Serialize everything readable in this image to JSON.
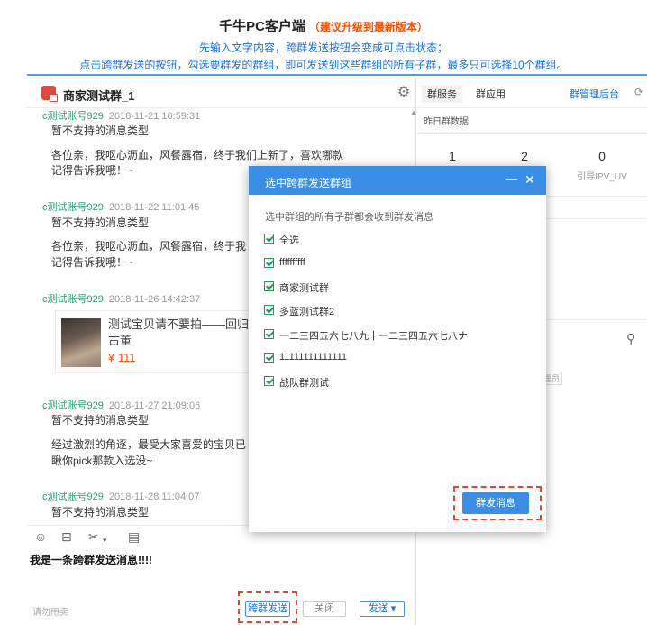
{
  "header": {
    "title": "千牛PC客户端",
    "title_note": "（建议升级到最新版本）",
    "instruction_line1": "先输入文字内容，跨群发送按钮会变成可点击状态；",
    "instruction_line2": "点击跨群发送的按钮，勾选要群发的群组，即可发送到这些群组的所有子群，最多只可选择10个群组。"
  },
  "chat": {
    "title": "商家测试群_1",
    "messages": [
      {
        "sender": "c测试账号929",
        "time": "2018-11-21 10:59:31",
        "lines": [
          "暂不支持的消息类型"
        ]
      },
      {
        "sender": "",
        "time": "",
        "lines": [
          "各位亲，我呕心沥血，风餐露宿，终于我们上新了，喜欢哪款",
          "记得告诉我哦！~"
        ]
      },
      {
        "sender": "c测试账号929",
        "time": "2018-11-22 11:01:45",
        "lines": [
          "暂不支持的消息类型"
        ]
      },
      {
        "sender": "",
        "time": "",
        "lines": [
          "各位亲，我呕心沥血，风餐露宿，终于我",
          "记得告诉我哦！~"
        ]
      },
      {
        "sender": "c测试账号929",
        "time": "2018-11-26 14:42:37",
        "lines": []
      },
      {
        "sender": "c测试账号929",
        "time": "2018-11-27 21:09:06",
        "lines": [
          "暂不支持的消息类型"
        ]
      },
      {
        "sender": "",
        "time": "",
        "lines": [
          "经过激烈的角逐，最受大家喜爱的宝贝已",
          "瞅你pick那款入选没~"
        ]
      },
      {
        "sender": "c测试账号929",
        "time": "2018-11-28 11:04:07",
        "lines": [
          "暂不支持的消息类型"
        ]
      }
    ],
    "product": {
      "name_line1": "测试宝贝请不要拍——回归",
      "name_line2": "古董",
      "price": "¥ 111"
    },
    "toolbar_icons": [
      "smile-icon",
      "screenshot-icon",
      "scissors-icon",
      "history-icon"
    ],
    "draft_text": "我是一条跨群发送消息!!!!",
    "hint": "请勿甩卖",
    "cross_send_label": "跨群发送",
    "close_label": "关闭",
    "send_label": "发送 ▾"
  },
  "side": {
    "tab_service": "群服务",
    "tab_apps": "群应用",
    "admin_link": "群管理后台",
    "yesterday_title": "昨日群数据",
    "stats": [
      {
        "value": "1",
        "label": ""
      },
      {
        "value": "2",
        "label": ""
      },
      {
        "value": "0",
        "label": "引导IPV_UV"
      }
    ],
    "member_tag": "理员"
  },
  "modal": {
    "title": "选中跨群发送群组",
    "subtitle": "选中群组的所有子群都会收到群发消息",
    "options": [
      {
        "label": "全选",
        "checked": true
      },
      {
        "label": "ffffffffff",
        "checked": true
      },
      {
        "label": "商家测试群",
        "checked": true
      },
      {
        "label": "多蓝测试群2",
        "checked": true
      },
      {
        "label": "一二三四五六七八九十一二三四五六七八ナ",
        "checked": true
      },
      {
        "label": "11111111111111",
        "checked": true
      },
      {
        "label": "战队群测试",
        "checked": true
      }
    ],
    "send_label": "群发消息"
  },
  "colors": {
    "accent": "#3a8ee6",
    "highlight_dash": "#e8442a",
    "sender": "#27a17c",
    "price": "#ff5000"
  }
}
